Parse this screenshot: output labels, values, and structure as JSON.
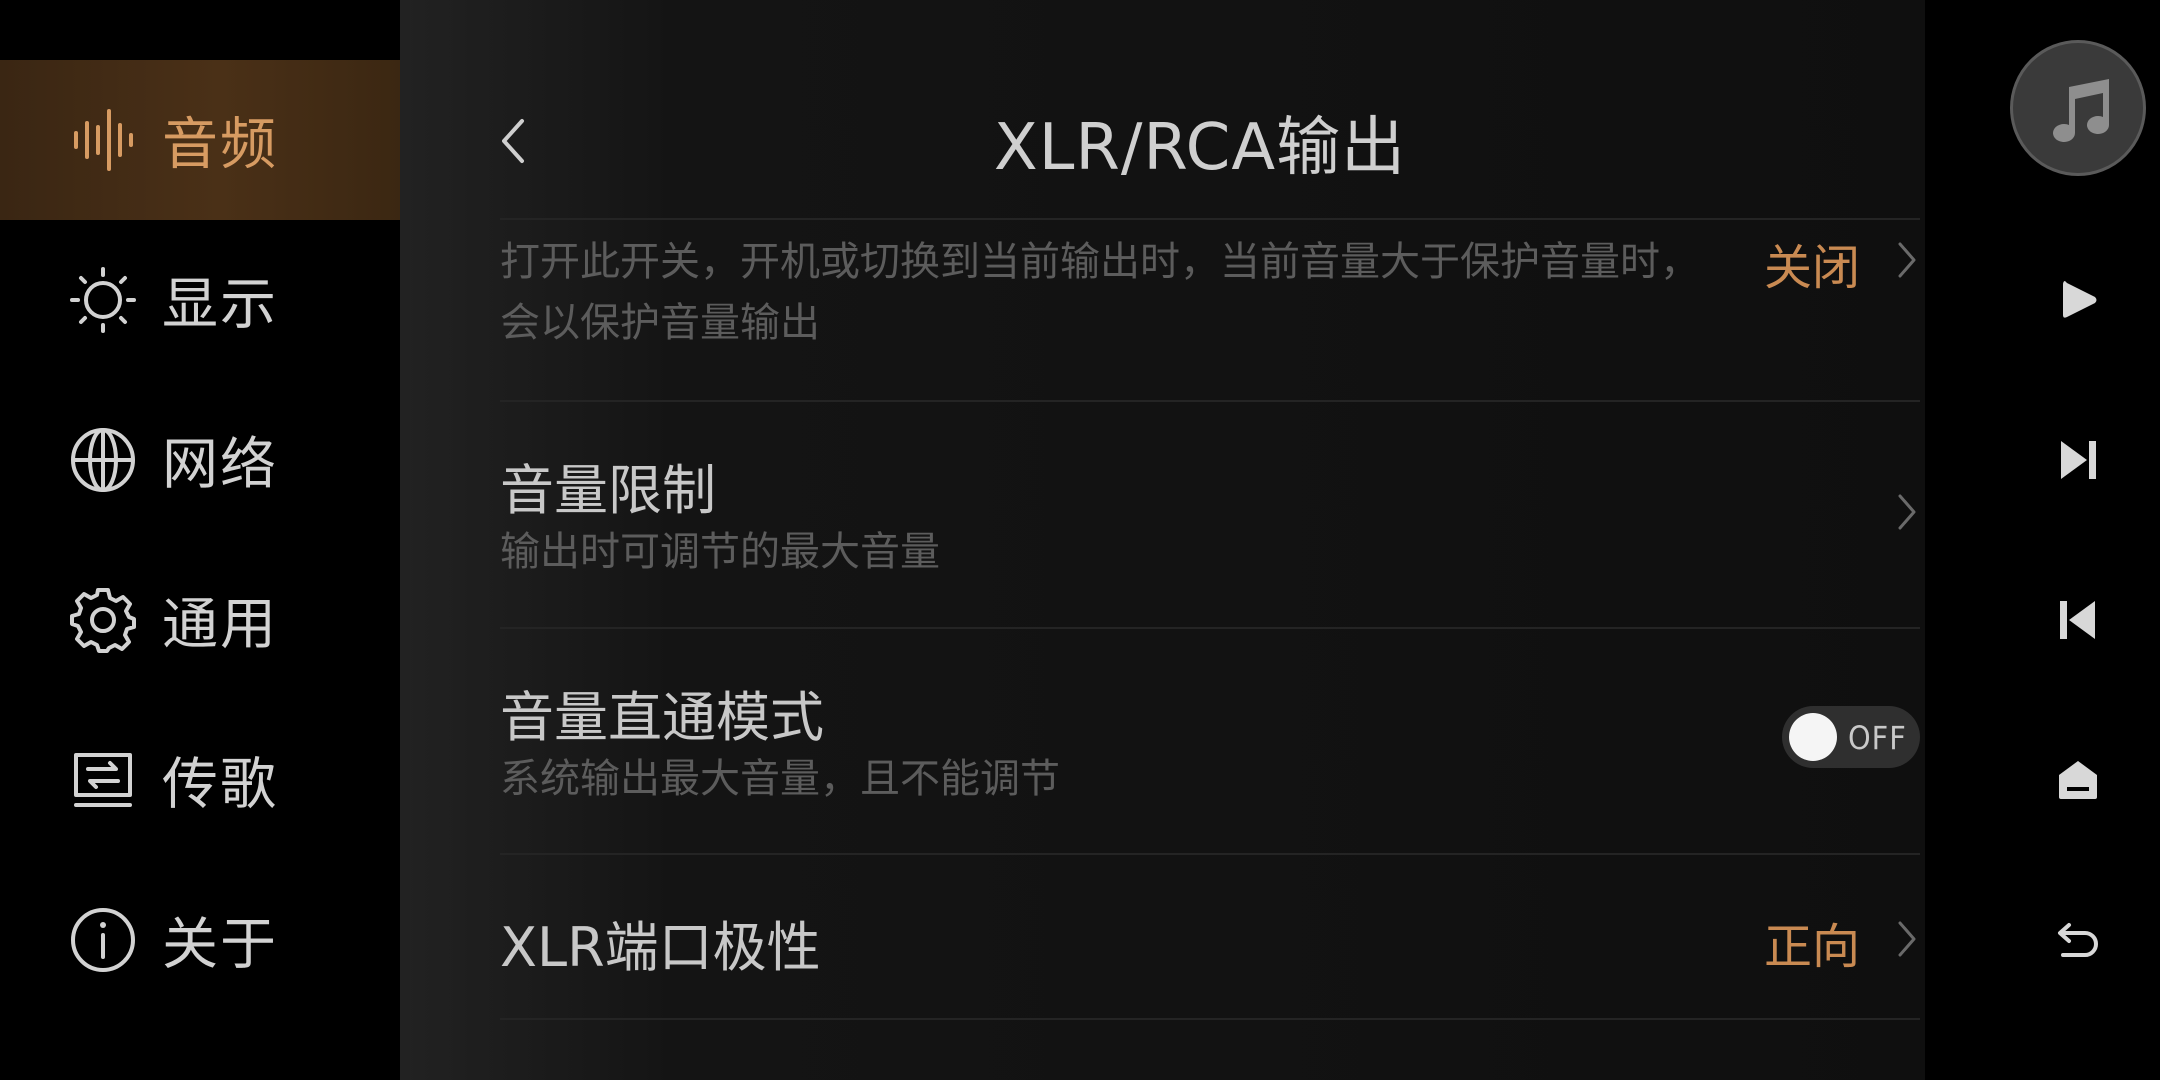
{
  "sidebar": {
    "items": [
      {
        "label": "音频",
        "icon": "audio-waveform-icon",
        "active": true
      },
      {
        "label": "显示",
        "icon": "sun-icon",
        "active": false
      },
      {
        "label": "网络",
        "icon": "globe-icon",
        "active": false
      },
      {
        "label": "通用",
        "icon": "gear-icon",
        "active": false
      },
      {
        "label": "传歌",
        "icon": "transfer-icon",
        "active": false
      },
      {
        "label": "关于",
        "icon": "info-icon",
        "active": false
      }
    ]
  },
  "header": {
    "title": "XLR/RCA输出",
    "back_icon": "chevron-left-icon"
  },
  "settings": {
    "protect_volume": {
      "description": "打开此开关，开机或切换到当前输出时，当前音量大于保护音量时，会以保护音量输出",
      "value": "关闭"
    },
    "volume_limit": {
      "title": "音量限制",
      "description": "输出时可调节的最大音量"
    },
    "direct_mode": {
      "title": "音量直通模式",
      "description": "系统输出最大音量，且不能调节",
      "toggle_label": "OFF",
      "toggle_on": false
    },
    "xlr_polarity": {
      "title": "XLR端口极性",
      "value": "正向"
    }
  },
  "controls": {
    "items": [
      "music-note-icon",
      "play-icon",
      "skip-next-icon",
      "skip-previous-icon",
      "home-icon",
      "back-arrow-icon"
    ]
  },
  "colors": {
    "accent": "#c98a52",
    "active_bg": "#4a3017",
    "background": "#000000"
  }
}
